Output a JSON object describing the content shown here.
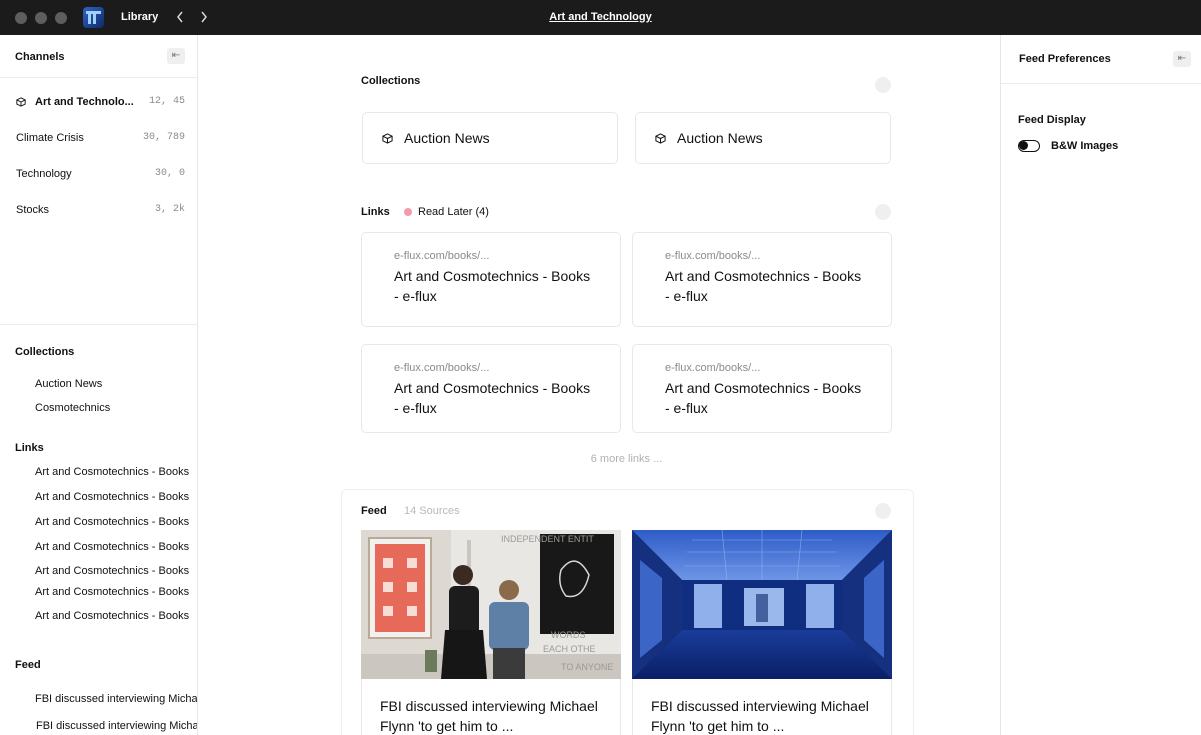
{
  "titlebar": {
    "library_label": "Library",
    "back_icon": "chevron-left-icon",
    "forward_icon": "chevron-right-icon",
    "title": "Art  and Technology"
  },
  "left_sidebar": {
    "header": "Channels",
    "collapse_icon": "collapse-left-icon",
    "channels": [
      {
        "name": "Art and Technolo...",
        "count": "12, 45",
        "icon": "cube-icon",
        "active": true
      },
      {
        "name": "Climate Crisis",
        "count": "30, 789"
      },
      {
        "name": "Technology",
        "count": "30, 0"
      },
      {
        "name": "Stocks",
        "count": "3, 2k"
      }
    ],
    "collections_title": "Collections",
    "collections": [
      "Auction News",
      "Cosmotechnics"
    ],
    "links_title": "Links",
    "links": [
      "Art and Cosmotechnics - Books",
      "Art and Cosmotechnics - Books",
      "Art and Cosmotechnics - Books",
      "Art and Cosmotechnics - Books",
      "Art and Cosmotechnics - Books",
      "Art and Cosmotechnics - Books",
      "Art and Cosmotechnics - Books"
    ],
    "feed_title": "Feed",
    "feed": [
      "FBI discussed interviewing Michael",
      "FBI discussed interviewing Michael"
    ]
  },
  "main": {
    "collections_title": "Collections",
    "collection_cards": [
      {
        "label": "Auction News",
        "icon": "cube-icon"
      },
      {
        "label": "Auction News",
        "icon": "cube-icon"
      }
    ],
    "links_title": "Links",
    "read_later": "Read Later (4)",
    "read_later_color": "#f29aa9",
    "link_cards": [
      {
        "url": "e-flux.com/books/...",
        "title": "Art and Cosmotechnics - Books - e-flux"
      },
      {
        "url": "e-flux.com/books/...",
        "title": "Art and Cosmotechnics - Books - e-flux"
      },
      {
        "url": "e-flux.com/books/...",
        "title": "Art and Cosmotechnics - Books - e-flux"
      },
      {
        "url": "e-flux.com/books/...",
        "title": "Art and Cosmotechnics - Books - e-flux"
      }
    ],
    "more_links": "6 more links ...",
    "feed_title": "Feed",
    "feed_sources": "14 Sources",
    "feed_cards": [
      {
        "image": "gallery-photo-two-people",
        "title": "FBI discussed interviewing Michael Flynn 'to get him to ..."
      },
      {
        "image": "blue-video-installation-room",
        "title": "FBI discussed interviewing Michael Flynn 'to get him to ..."
      }
    ]
  },
  "right_sidebar": {
    "header": "Feed Preferences",
    "collapse_icon": "collapse-left-icon",
    "feed_display_label": "Feed Display",
    "toggle_label": "B&W Images",
    "toggle_on": false
  }
}
